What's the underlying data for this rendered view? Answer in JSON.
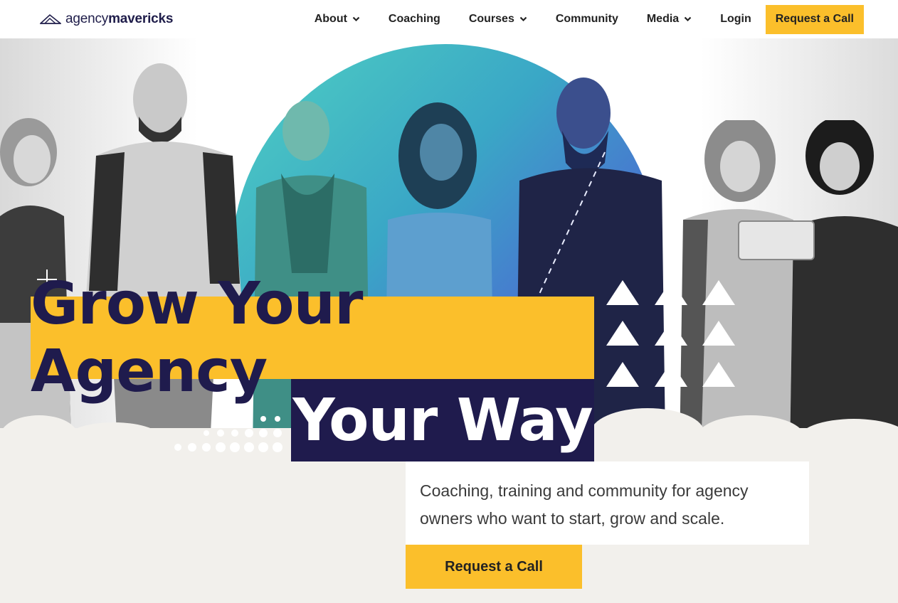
{
  "header": {
    "logo": {
      "text_light": "agency",
      "text_bold": "mavericks"
    },
    "nav": [
      {
        "label": "About",
        "has_dropdown": true
      },
      {
        "label": "Coaching",
        "has_dropdown": false
      },
      {
        "label": "Courses",
        "has_dropdown": true
      },
      {
        "label": "Community",
        "has_dropdown": false
      },
      {
        "label": "Media",
        "has_dropdown": true
      },
      {
        "label": "Login",
        "has_dropdown": false
      }
    ],
    "cta_label": "Request a Call"
  },
  "hero": {
    "headline_line1": "Grow Your Agency",
    "headline_line2": "Your Way",
    "subtext": "Coaching, training and community for agency owners who want to start, grow and scale.",
    "cta_label": "Request a Call"
  },
  "colors": {
    "accent_yellow": "#fbbf2b",
    "navy": "#1f1b4d",
    "background": "#f2f0ec"
  },
  "icons": {
    "logo_mark": "paper-plane-mountain-icon",
    "dropdown": "chevron-down-icon",
    "crosshair": "plus-crosshair-icon",
    "triangles": "triangle-pattern-icon"
  }
}
